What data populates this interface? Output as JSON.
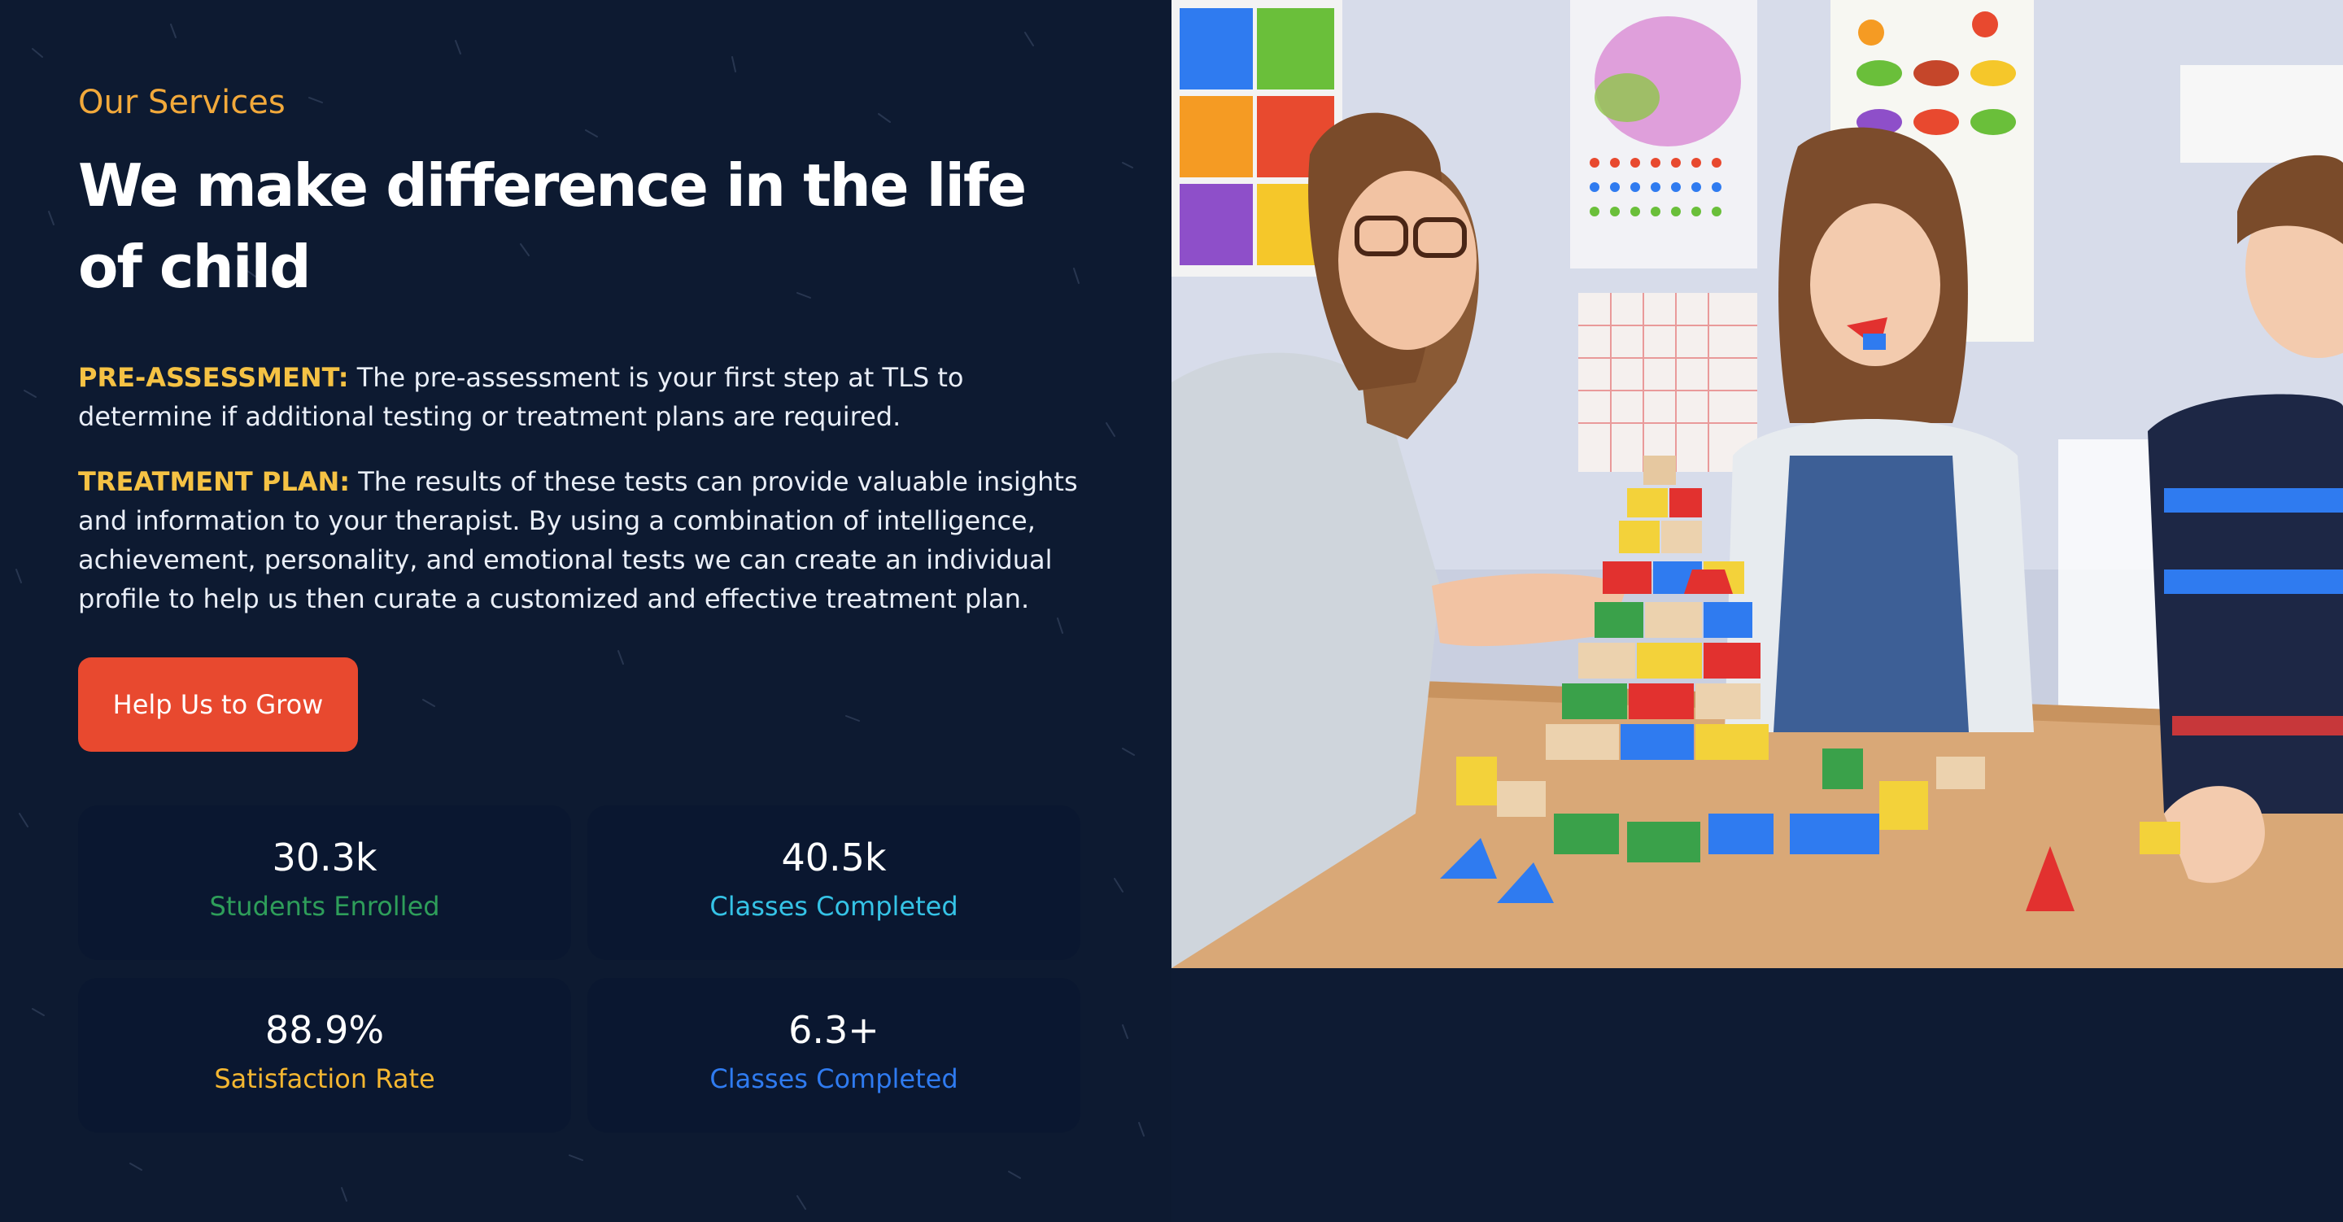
{
  "section": {
    "eyebrow": "Our Services",
    "title": "We make difference in the life of child"
  },
  "paragraphs": [
    {
      "lead": "PRE-ASSESSMENT:",
      "text": " The pre-assessment is your first step at TLS to determine if additional testing or treatment plans are required."
    },
    {
      "lead": "TREATMENT PLAN:",
      "text": " The results of these tests can provide valuable insights and information to your therapist. By using a combination of intelligence, achievement, personality, and emotional tests we can create an individual profile to help us then curate a customized and effective treatment plan."
    }
  ],
  "cta": {
    "label": "Help Us to Grow"
  },
  "stats": [
    {
      "value": "30.3k",
      "label": "Students Enrolled",
      "color": "#2e9e5a"
    },
    {
      "value": "40.5k",
      "label": "Classes Completed",
      "color": "#35c3e6"
    },
    {
      "value": "88.9%",
      "label": "Satisfaction Rate",
      "color": "#f5b731"
    },
    {
      "value": "6.3+",
      "label": "Classes Completed",
      "color": "#2f7bf0"
    }
  ],
  "colors": {
    "background": "#0e1b33",
    "accent_orange": "#f2a93b",
    "button": "#e8492f",
    "card": "#0a1730"
  },
  "image": {
    "icon": "classroom-photo"
  }
}
